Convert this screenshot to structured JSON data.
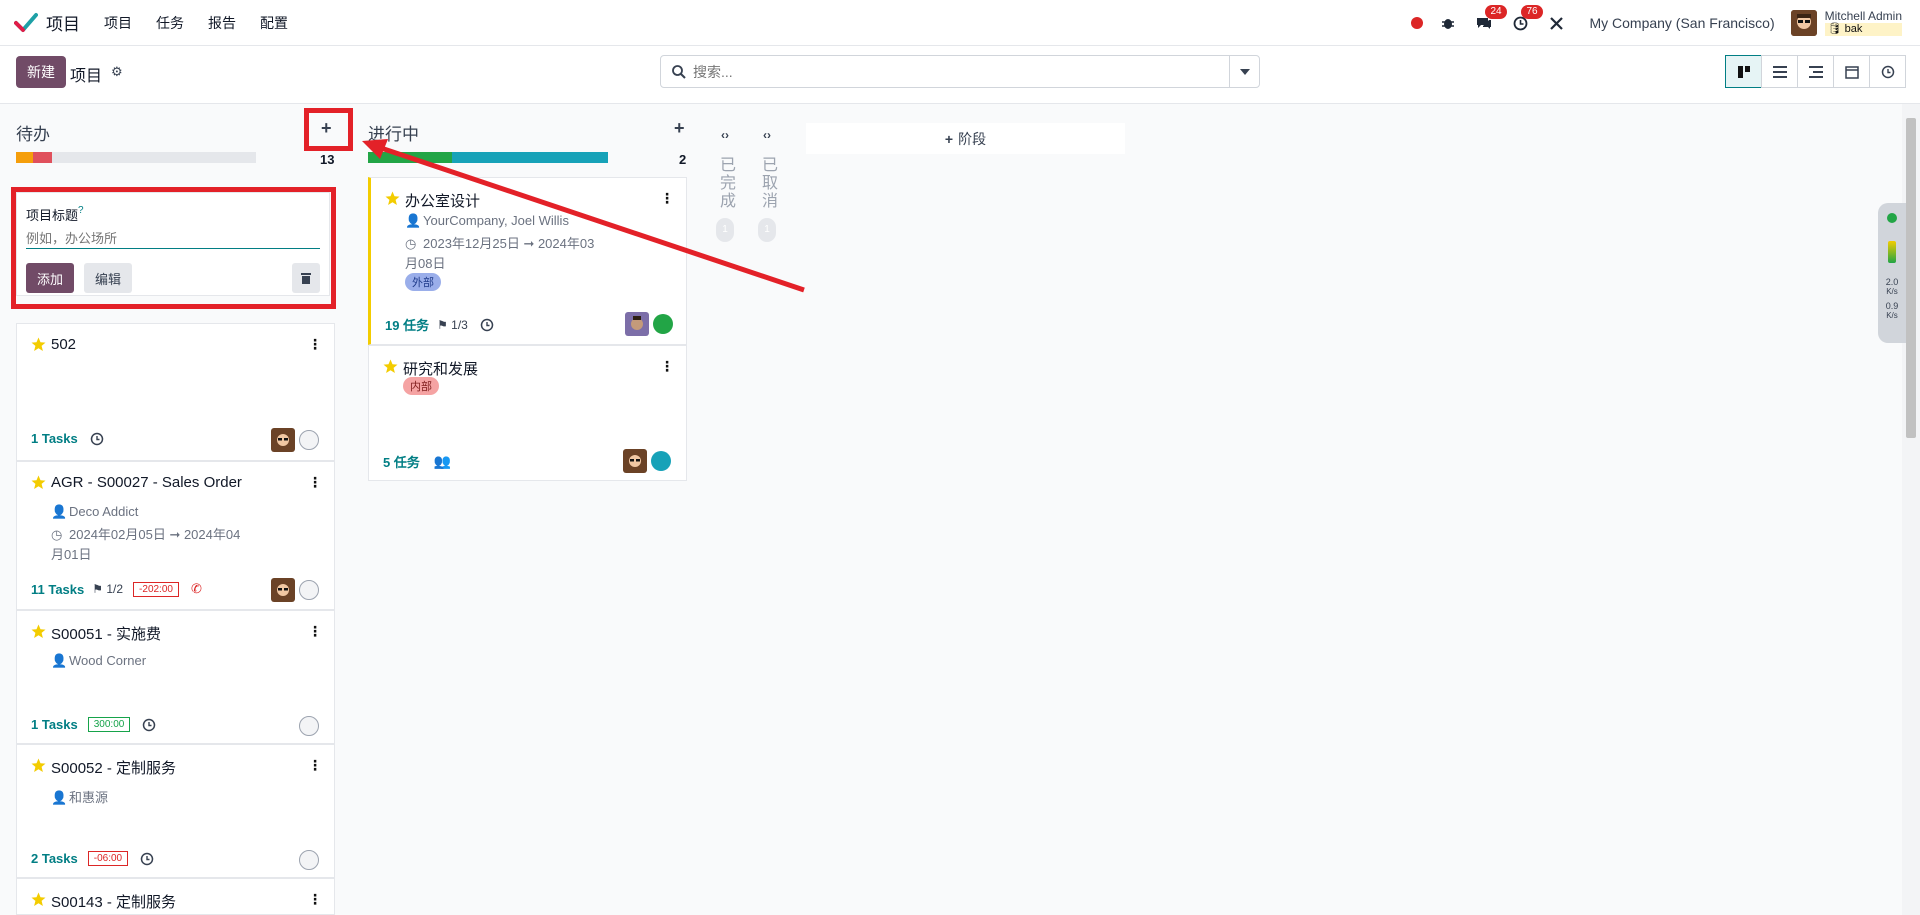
{
  "navbar": {
    "app_name": "项目",
    "menu": [
      "项目",
      "任务",
      "报告",
      "配置"
    ],
    "messages_badge": "24",
    "activities_badge": "76",
    "company": "My Company (San Francisco)",
    "user_name": "Mitchell Admin",
    "db_name": "bak"
  },
  "control_panel": {
    "new_label": "新建",
    "breadcrumb": "项目",
    "search_placeholder": "搜索...",
    "views": [
      "kanban-icon",
      "list-icon",
      "activity-list-icon",
      "calendar-icon",
      "clock-icon"
    ]
  },
  "columns": {
    "todo": {
      "title": "待办",
      "count": "13",
      "progress": {
        "orange": 0.07,
        "red": 0.08
      }
    },
    "in_progress": {
      "title": "进行中",
      "count": "2",
      "progress": {
        "green": 0.35,
        "teal": 0.65
      }
    },
    "done": {
      "title": "已完成",
      "count": "1"
    },
    "cancelled": {
      "title": "已取消",
      "count": "1"
    },
    "add_stage_label": "阶段"
  },
  "quick_create": {
    "label": "项目标题",
    "help": "?",
    "placeholder": "例如，办公场所",
    "add_label": "添加",
    "edit_label": "编辑"
  },
  "todo_cards": [
    {
      "title": "502",
      "tasks": "1 Tasks"
    },
    {
      "title": "AGR - S00027 - Sales Order",
      "partner": "Deco Addict",
      "date_line1": "2024年02月05日 ➞ 2024年04",
      "date_line2": "月01日",
      "tasks": "11 Tasks",
      "milestone": "1/2",
      "time": "-202:00"
    },
    {
      "title": "S00051 - 实施费",
      "partner": "Wood Corner",
      "tasks": "1 Tasks",
      "time": "300:00"
    },
    {
      "title": "S00052 - 定制服务",
      "partner": "和惠源",
      "tasks": "2 Tasks",
      "time": "-06:00"
    },
    {
      "title": "S00143 - 定制服务"
    }
  ],
  "progress_cards": [
    {
      "title": "办公室设计",
      "partner": "YourCompany, Joel Willis",
      "date_line1": "2023年12月25日 ➞ 2024年03",
      "date_line2": "月08日",
      "tag": "外部",
      "tasks": "19 任务",
      "milestone": "1/3"
    },
    {
      "title": "研究和发展",
      "tag": "内部",
      "tasks": "5 任务"
    }
  ],
  "side_widget": {
    "up": "2.0",
    "up_unit": "K/s",
    "down": "0.9",
    "down_unit": "K/s"
  },
  "colors": {
    "primary": "#714b67",
    "accent": "#017e84",
    "highlight": "#e32128"
  }
}
